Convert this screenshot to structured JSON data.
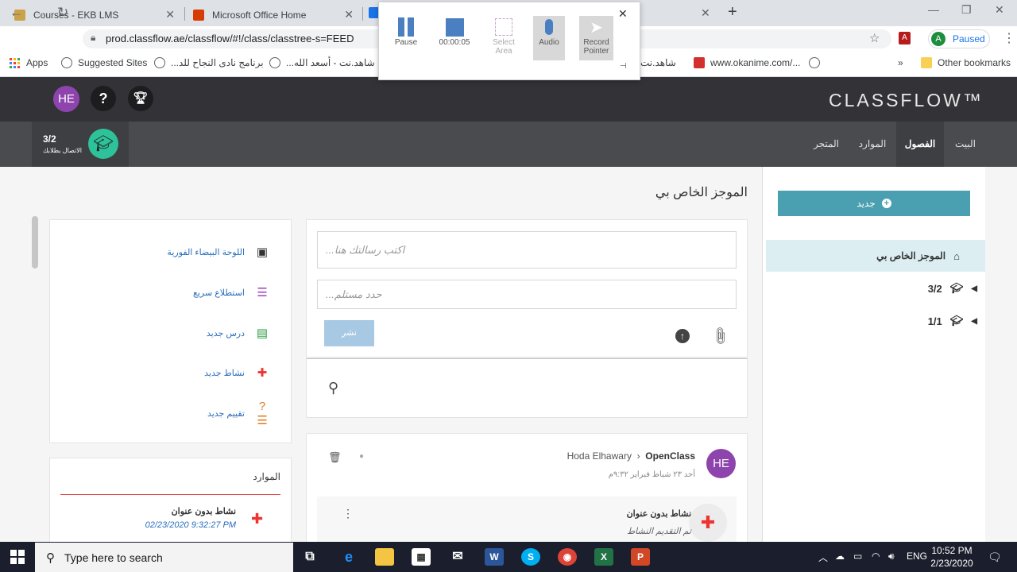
{
  "browser": {
    "tabs": [
      {
        "title": "Courses - EKB LMS"
      },
      {
        "title": "Microsoft Office Home"
      }
    ],
    "url": "prod.classflow.ae/classflow/#!/class/classtree-s=FEED",
    "profile_initial": "A",
    "profile_status": "Paused",
    "bookmarks": [
      "Apps",
      "Suggested Sites",
      "برنامج نادى النجاح للد...",
      "شاهد.نت - أسعد الله...",
      "شاهد.نت",
      "www.okanime.com/..."
    ],
    "bookmarks_more": "»",
    "other_bookmarks": "Other bookmarks"
  },
  "recorder": {
    "pause": "Pause",
    "timer": "00:00:05",
    "select_area": "Select Area",
    "audio": "Audio",
    "record_pointer": "Record Pointer"
  },
  "app": {
    "logo": "CLASSFLOW™",
    "user_initials": "HE",
    "help_icon": "?",
    "class_label": "3/2",
    "class_sub": "الاتصال بطلابك",
    "nav": {
      "home": "البيت",
      "classes": "الفصول",
      "resources": "الموارد",
      "store": "المتجر"
    }
  },
  "sidebar": {
    "new_button": "جديد",
    "my_feed": "الموجز الخاص بي",
    "classes": [
      "3/2",
      "1/1"
    ]
  },
  "feed": {
    "title": "الموجز الخاص بي",
    "message_placeholder": "اكتب رسالتك هنا...",
    "recipient_placeholder": "حدد مستلم...",
    "post_button": "نشر"
  },
  "post": {
    "avatar": "HE",
    "author": "Hoda Elhawary",
    "target": "OpenClass",
    "date": "أحد ٢٣ شباط فبراير ٩:٣٢م",
    "attachment_title": "نشاط بدون عنوان",
    "attachment_status": "تم التقديم النشاط"
  },
  "quick_actions": [
    {
      "label": "اللوحة البيضاء الفورية",
      "icon": "whiteboard-icon"
    },
    {
      "label": "استطلاع سريع",
      "icon": "poll-icon"
    },
    {
      "label": "درس جديد",
      "icon": "lesson-icon"
    },
    {
      "label": "نشاط جديد",
      "icon": "puzzle-icon"
    },
    {
      "label": "تقييم جديد",
      "icon": "assessment-icon"
    }
  ],
  "resources": {
    "title": "الموارد",
    "item_name": "نشاط بدون عنوان",
    "item_date": "02/23/2020 9:32:27 PM"
  },
  "taskbar": {
    "search_placeholder": "Type here to search",
    "lang": "ENG",
    "time": "10:52 PM",
    "date": "2/23/2020"
  },
  "colors": {
    "accent": "#4a9fb0",
    "header": "#333337",
    "avatar": "#8e44ad",
    "class_circle": "#2ec29a"
  }
}
